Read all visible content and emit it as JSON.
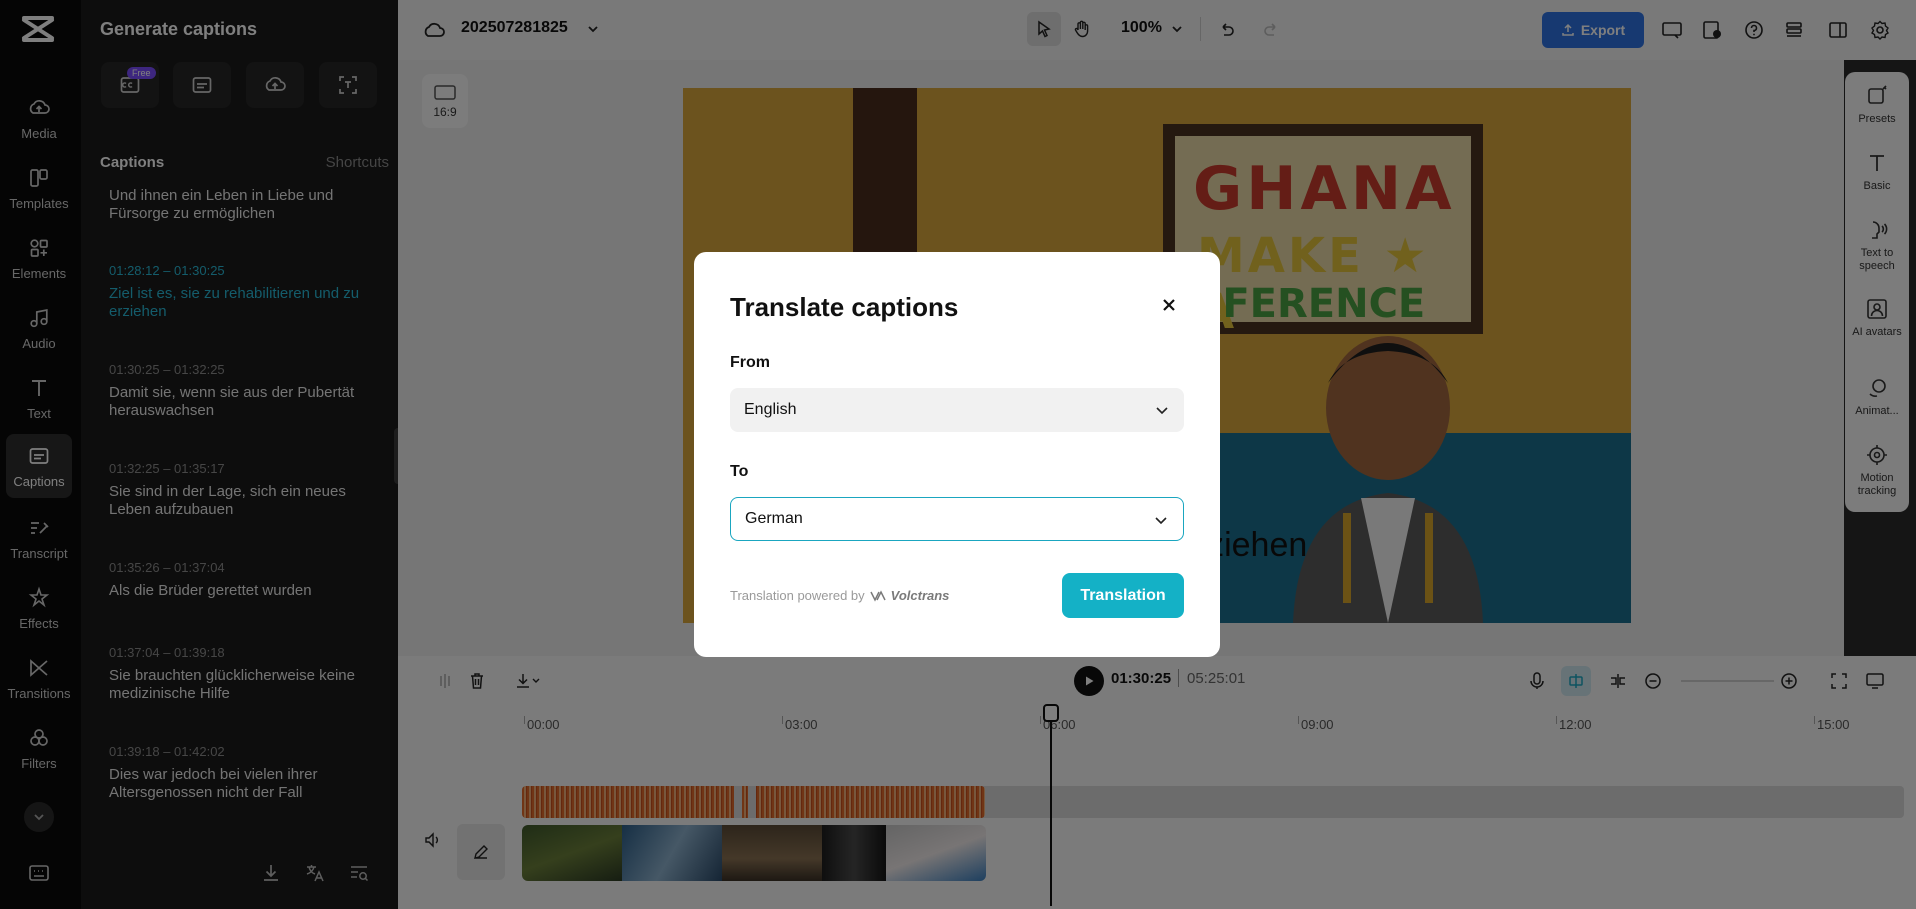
{
  "rail": {
    "items": [
      {
        "label": "Media",
        "icon": "cloud-upload-icon"
      },
      {
        "label": "Templates",
        "icon": "templates-icon"
      },
      {
        "label": "Elements",
        "icon": "elements-icon"
      },
      {
        "label": "Audio",
        "icon": "music-note-icon"
      },
      {
        "label": "Text",
        "icon": "text-icon"
      },
      {
        "label": "Captions",
        "icon": "captions-icon"
      },
      {
        "label": "Transcript",
        "icon": "transcript-icon"
      },
      {
        "label": "Effects",
        "icon": "effects-icon"
      },
      {
        "label": "Transitions",
        "icon": "transitions-icon"
      },
      {
        "label": "Filters",
        "icon": "filters-icon"
      }
    ],
    "active": "Captions"
  },
  "panel": {
    "title": "Generate captions",
    "free_badge": "Free",
    "captions_heading": "Captions",
    "shortcuts_label": "Shortcuts",
    "captions": [
      {
        "time": "",
        "text": "Und ihnen ein Leben in Liebe und Fürsorge zu ermöglichen"
      },
      {
        "time": "01:28:12 – 01:30:25",
        "text": "Ziel ist es, sie zu rehabilitieren und zu erziehen",
        "active": true
      },
      {
        "time": "01:30:25 – 01:32:25",
        "text": "Damit sie, wenn sie aus der Pubertät herauswachsen"
      },
      {
        "time": "01:32:25 – 01:35:17",
        "text": "Sie sind in der Lage, sich ein neues Leben aufzubauen"
      },
      {
        "time": "01:35:26 – 01:37:04",
        "text": "Als die Brüder gerettet wurden"
      },
      {
        "time": "01:37:04 – 01:39:18",
        "text": "Sie brauchten glücklicherweise keine medizinische Hilfe"
      },
      {
        "time": "01:39:18 – 01:42:02",
        "text": "Dies war jedoch bei vielen ihrer Altersgenossen nicht der Fall"
      }
    ]
  },
  "topbar": {
    "project_name": "202507281825",
    "zoom": "100%",
    "export_label": "Export"
  },
  "canvas": {
    "ratio_label": "16:9",
    "video_caption": "ren und zu erziehen",
    "sign_line1": "GHANA",
    "sign_line2": "MAKE ★ A",
    "sign_line3": "FFERENCE"
  },
  "right_panel": {
    "items": [
      {
        "label": "Presets"
      },
      {
        "label": "Basic"
      },
      {
        "label": "Text to speech"
      },
      {
        "label": "AI avatars"
      },
      {
        "label": "Animat..."
      },
      {
        "label": "Motion tracking"
      }
    ]
  },
  "timeline": {
    "current_time": "01:30:25",
    "total_time": "05:25:01",
    "ruler": [
      "00:00",
      "03:00",
      "06:00",
      "09:00",
      "12:00",
      "15:00"
    ]
  },
  "modal": {
    "title": "Translate captions",
    "from_label": "From",
    "from_value": "English",
    "to_label": "To",
    "to_value": "German",
    "powered_by": "Translation powered by",
    "provider": "Volctrans",
    "submit_label": "Translation"
  },
  "colors": {
    "accent": "#14b1c6",
    "export_blue": "#2f73e3",
    "active_caption": "#28b8d6"
  }
}
